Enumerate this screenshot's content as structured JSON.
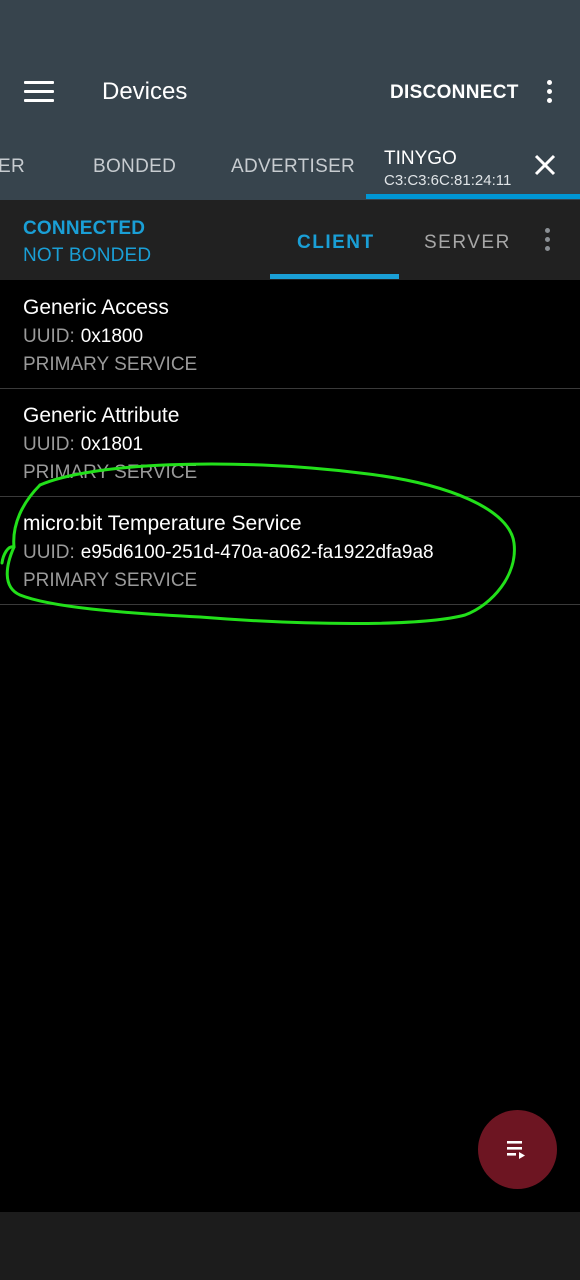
{
  "app_bar": {
    "title": "Devices",
    "disconnect_label": "DISCONNECT"
  },
  "device_tabs": {
    "items": [
      "ER",
      "BONDED",
      "ADVERTISER"
    ],
    "active": {
      "name": "TINYGO",
      "address": "C3:C3:6C:81:24:11"
    }
  },
  "status": {
    "connection": "CONNECTED",
    "bond": "NOT BONDED"
  },
  "sub_tabs": {
    "client": "CLIENT",
    "server": "SERVER",
    "active": "CLIENT"
  },
  "services": [
    {
      "name": "Generic Access",
      "uuid_label": "UUID:",
      "uuid": "0x1800",
      "type": "PRIMARY SERVICE"
    },
    {
      "name": "Generic Attribute",
      "uuid_label": "UUID:",
      "uuid": "0x1801",
      "type": "PRIMARY SERVICE"
    },
    {
      "name": "micro:bit Temperature Service",
      "uuid_label": "UUID:",
      "uuid": "e95d6100-251d-470a-a062-fa1922dfa9a8",
      "type": "PRIMARY SERVICE"
    }
  ],
  "colors": {
    "app_bar": "#37444d",
    "accent": "#1a9fd6",
    "fab": "#6d1522",
    "annotation": "#22e01a"
  },
  "icons": {
    "menu": "hamburger-menu-icon",
    "overflow": "more-vert-icon",
    "close": "close-icon",
    "fab": "playlist-play-icon"
  }
}
